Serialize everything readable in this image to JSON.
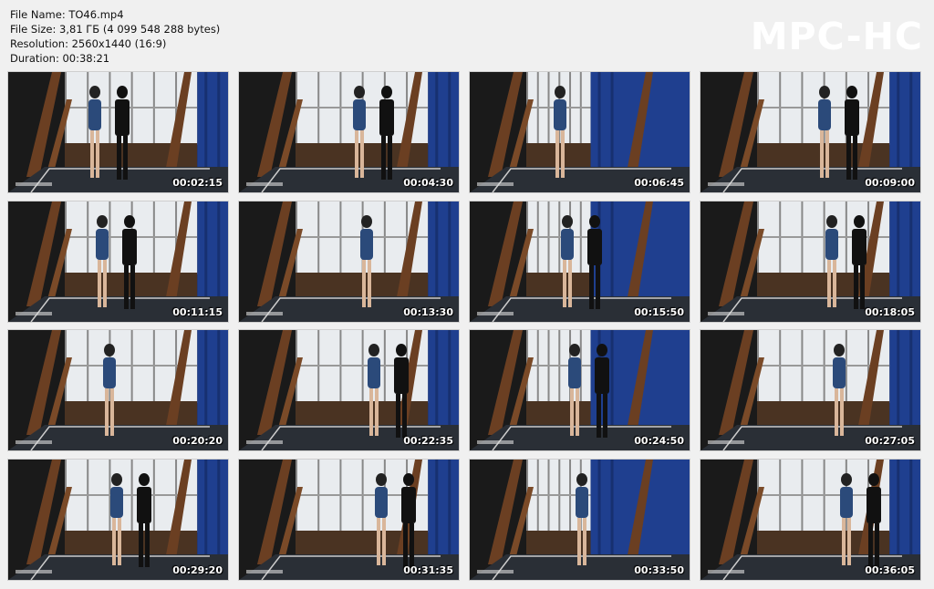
{
  "info": {
    "file_name": "File Name: TO46.mp4",
    "file_size": "File Size: 3,81 ГБ (4 099 548 288 bytes)",
    "resolution": "Resolution: 2560x1440 (16:9)",
    "duration": "Duration: 00:38:21"
  },
  "logo": "MPC-HC",
  "thumbnails": [
    {
      "time": "00:02:15"
    },
    {
      "time": "00:04:30"
    },
    {
      "time": "00:06:45"
    },
    {
      "time": "00:09:00"
    },
    {
      "time": "00:11:15"
    },
    {
      "time": "00:13:30"
    },
    {
      "time": "00:15:50"
    },
    {
      "time": "00:18:05"
    },
    {
      "time": "00:20:20"
    },
    {
      "time": "00:22:35"
    },
    {
      "time": "00:24:50"
    },
    {
      "time": "00:27:05"
    },
    {
      "time": "00:29:20"
    },
    {
      "time": "00:31:35"
    },
    {
      "time": "00:33:50"
    },
    {
      "time": "00:36:05"
    }
  ],
  "colors": {
    "background": "#f0f0f0",
    "curtain": "#1f3f8f",
    "floor": "#2a2f36",
    "wood": "#6b3f22",
    "window": "#e9ecef"
  }
}
